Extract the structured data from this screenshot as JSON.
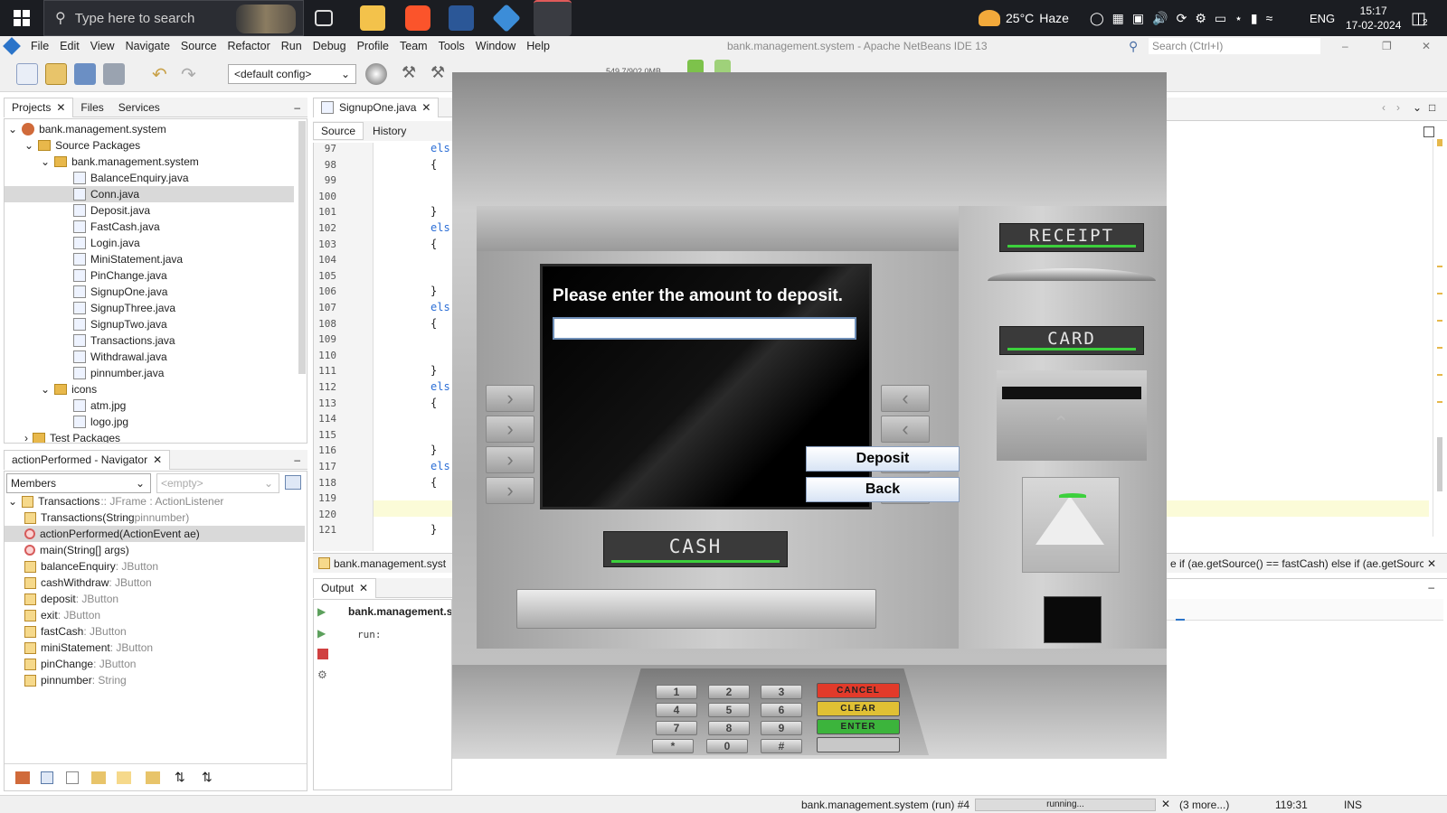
{
  "taskbar": {
    "search_placeholder": "Type here to search",
    "weather_temp": "25°C",
    "weather_desc": "Haze",
    "language": "ENG",
    "time": "15:17",
    "date": "17-02-2024",
    "notification_count": "2"
  },
  "ide": {
    "title": "bank.management.system - Apache NetBeans IDE 13",
    "menu": [
      "File",
      "Edit",
      "View",
      "Navigate",
      "Source",
      "Refactor",
      "Run",
      "Debug",
      "Profile",
      "Team",
      "Tools",
      "Window",
      "Help"
    ],
    "search_placeholder": "Search (Ctrl+I)",
    "config_select": "<default config>",
    "memory_readout": "549.7/902.0MB"
  },
  "projects_panel": {
    "tabs": [
      "Projects",
      "Files",
      "Services"
    ],
    "project": "bank.management.system",
    "source_packages": "Source Packages",
    "package": "bank.management.system",
    "files": [
      "BalanceEnquiry.java",
      "Conn.java",
      "Deposit.java",
      "FastCash.java",
      "Login.java",
      "MiniStatement.java",
      "PinChange.java",
      "SignupOne.java",
      "SignupThree.java",
      "SignupTwo.java",
      "Transactions.java",
      "Withdrawal.java",
      "pinnumber.java"
    ],
    "icons_package": "icons",
    "icon_files": [
      "atm.jpg",
      "logo.jpg"
    ],
    "test_packages": "Test Packages"
  },
  "navigator": {
    "title": "actionPerformed - Navigator",
    "filter": "Members",
    "filter2": "<empty>",
    "class_name": "Transactions",
    "class_sig": " :: JFrame : ActionListener",
    "members": [
      {
        "name": "Transactions(String",
        "type": " pinnumber)",
        "kind": "ctor"
      },
      {
        "name": "actionPerformed(ActionEvent ae)",
        "type": "",
        "kind": "method"
      },
      {
        "name": "main(String[] args)",
        "type": "",
        "kind": "method"
      },
      {
        "name": "balanceEnquiry",
        "type": " : JButton",
        "kind": "field"
      },
      {
        "name": "cashWithdraw",
        "type": " : JButton",
        "kind": "field"
      },
      {
        "name": "deposit",
        "type": " : JButton",
        "kind": "field"
      },
      {
        "name": "exit",
        "type": " : JButton",
        "kind": "field"
      },
      {
        "name": "fastCash",
        "type": " : JButton",
        "kind": "field"
      },
      {
        "name": "miniStatement",
        "type": " : JButton",
        "kind": "field"
      },
      {
        "name": "pinChange",
        "type": " : JButton",
        "kind": "field"
      },
      {
        "name": "pinnumber",
        "type": " : String",
        "kind": "field"
      }
    ]
  },
  "editor": {
    "tab": "SignupOne.java",
    "source_tab": "Source",
    "history_tab": "History",
    "lines": [
      "97",
      "98",
      "99",
      "100",
      "101",
      "102",
      "103",
      "104",
      "105",
      "106",
      "107",
      "108",
      "109",
      "110",
      "111",
      "112",
      "113",
      "114",
      "115",
      "116",
      "117",
      "118",
      "119",
      "120",
      "121"
    ],
    "code": [
      "els",
      "{",
      "",
      "",
      "}",
      "els",
      "{",
      "",
      "",
      "}",
      "els",
      "{",
      "",
      "",
      "}",
      "els",
      "{",
      "",
      "",
      "}",
      "els",
      "{",
      "",
      "",
      "}"
    ],
    "breadcrumb": "bank.management.syst",
    "breadcrumb_right": "e if (ae.getSource() == fastCash) else if (ae.getSource"
  },
  "output": {
    "tab": "Output",
    "run_label": "bank.management.sy",
    "run_text": "run:"
  },
  "atm": {
    "prompt": "Please enter the amount to deposit.",
    "amount_value": "",
    "deposit_button": "Deposit",
    "back_button": "Back",
    "receipt_label": "RECEIPT",
    "card_label": "CARD",
    "cash_label": "CASH",
    "keys": [
      "1",
      "2",
      "3",
      "4",
      "5",
      "6",
      "7",
      "8",
      "9",
      "*",
      "0",
      "#"
    ],
    "fkeys": [
      "CANCEL",
      "CLEAR",
      "ENTER"
    ]
  },
  "statusbar": {
    "run_status": "bank.management.system (run) #4",
    "progress_text": "running...",
    "more": "(3 more...)",
    "position": "119:31",
    "mode": "INS"
  }
}
